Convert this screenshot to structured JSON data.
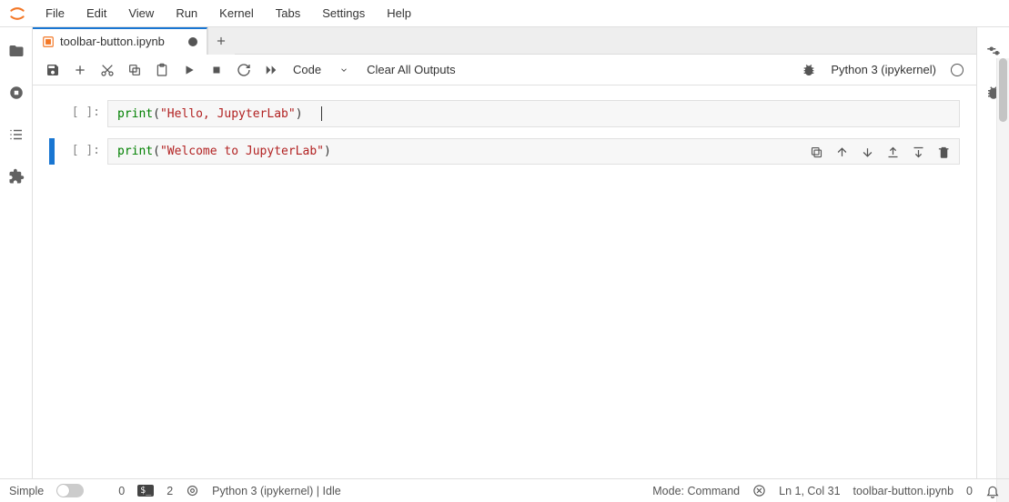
{
  "menu": {
    "items": [
      "File",
      "Edit",
      "View",
      "Run",
      "Kernel",
      "Tabs",
      "Settings",
      "Help"
    ]
  },
  "tab": {
    "filename": "toolbar-button.ipynb",
    "dirty": true
  },
  "toolbar": {
    "celltype": "Code",
    "clear_all": "Clear All Outputs",
    "kernel_name": "Python 3 (ipykernel)"
  },
  "cells": [
    {
      "prompt": "[ ]:",
      "code_fn": "print",
      "code_open": "(",
      "code_str": "\"Hello, JupyterLab\"",
      "code_close": ")",
      "active": false,
      "has_cursor": true
    },
    {
      "prompt": "[ ]:",
      "code_fn": "print",
      "code_open": "(",
      "code_str": "\"Welcome to JupyterLab\"",
      "code_close": ")",
      "active": true,
      "has_cursor": false,
      "show_toolbar": true
    }
  ],
  "status": {
    "simple_label": "Simple",
    "error_count": "0",
    "terminal_count": "2",
    "kernel_status": "Python 3 (ipykernel) | Idle",
    "mode": "Mode: Command",
    "cursor": "Ln 1, Col 31",
    "filename": "toolbar-button.ipynb",
    "notif_count": "0"
  }
}
